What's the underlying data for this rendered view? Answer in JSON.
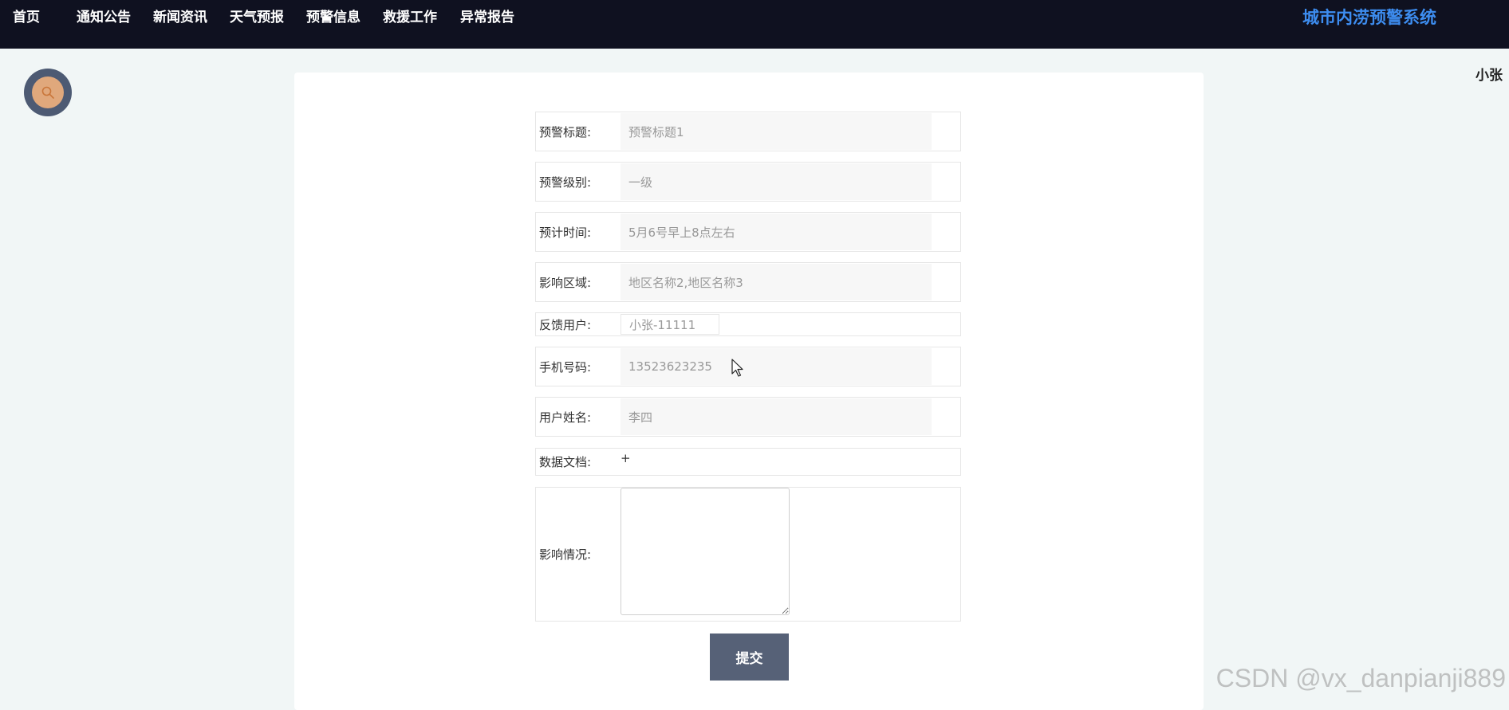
{
  "nav": {
    "items": [
      {
        "label": "首页"
      },
      {
        "label": "通知公告"
      },
      {
        "label": "新闻资讯"
      },
      {
        "label": "天气预报"
      },
      {
        "label": "预警信息"
      },
      {
        "label": "救援工作"
      },
      {
        "label": "异常报告"
      }
    ],
    "brand": "城市内涝预警系统"
  },
  "user": {
    "name": "小张"
  },
  "form": {
    "title": {
      "label": "预警标题:",
      "value": "预警标题1"
    },
    "level": {
      "label": "预警级别:",
      "value": "一级"
    },
    "time": {
      "label": "预计时间:",
      "value": "5月6号早上8点左右"
    },
    "area": {
      "label": "影响区域:",
      "value": "地区名称2,地区名称3"
    },
    "feedback_user": {
      "label": "反馈用户:",
      "value": "小张-11111"
    },
    "phone": {
      "label": "手机号码:",
      "value": "13523623235"
    },
    "username": {
      "label": "用户姓名:",
      "value": "李四"
    },
    "document": {
      "label": "数据文档:",
      "add_symbol": "+"
    },
    "impact": {
      "label": "影响情况:",
      "value": ""
    },
    "submit_label": "提交"
  },
  "icons": {
    "search": "search-icon",
    "cursor": "mouse-pointer-icon",
    "add": "plus-icon"
  },
  "colors": {
    "topbar": "#0f1120",
    "brand": "#3d8df0",
    "submit": "#566177",
    "search_fab_outer": "#4d5a73",
    "search_fab_inner": "#e0a87c"
  },
  "watermark": "CSDN @vx_danpianji889"
}
